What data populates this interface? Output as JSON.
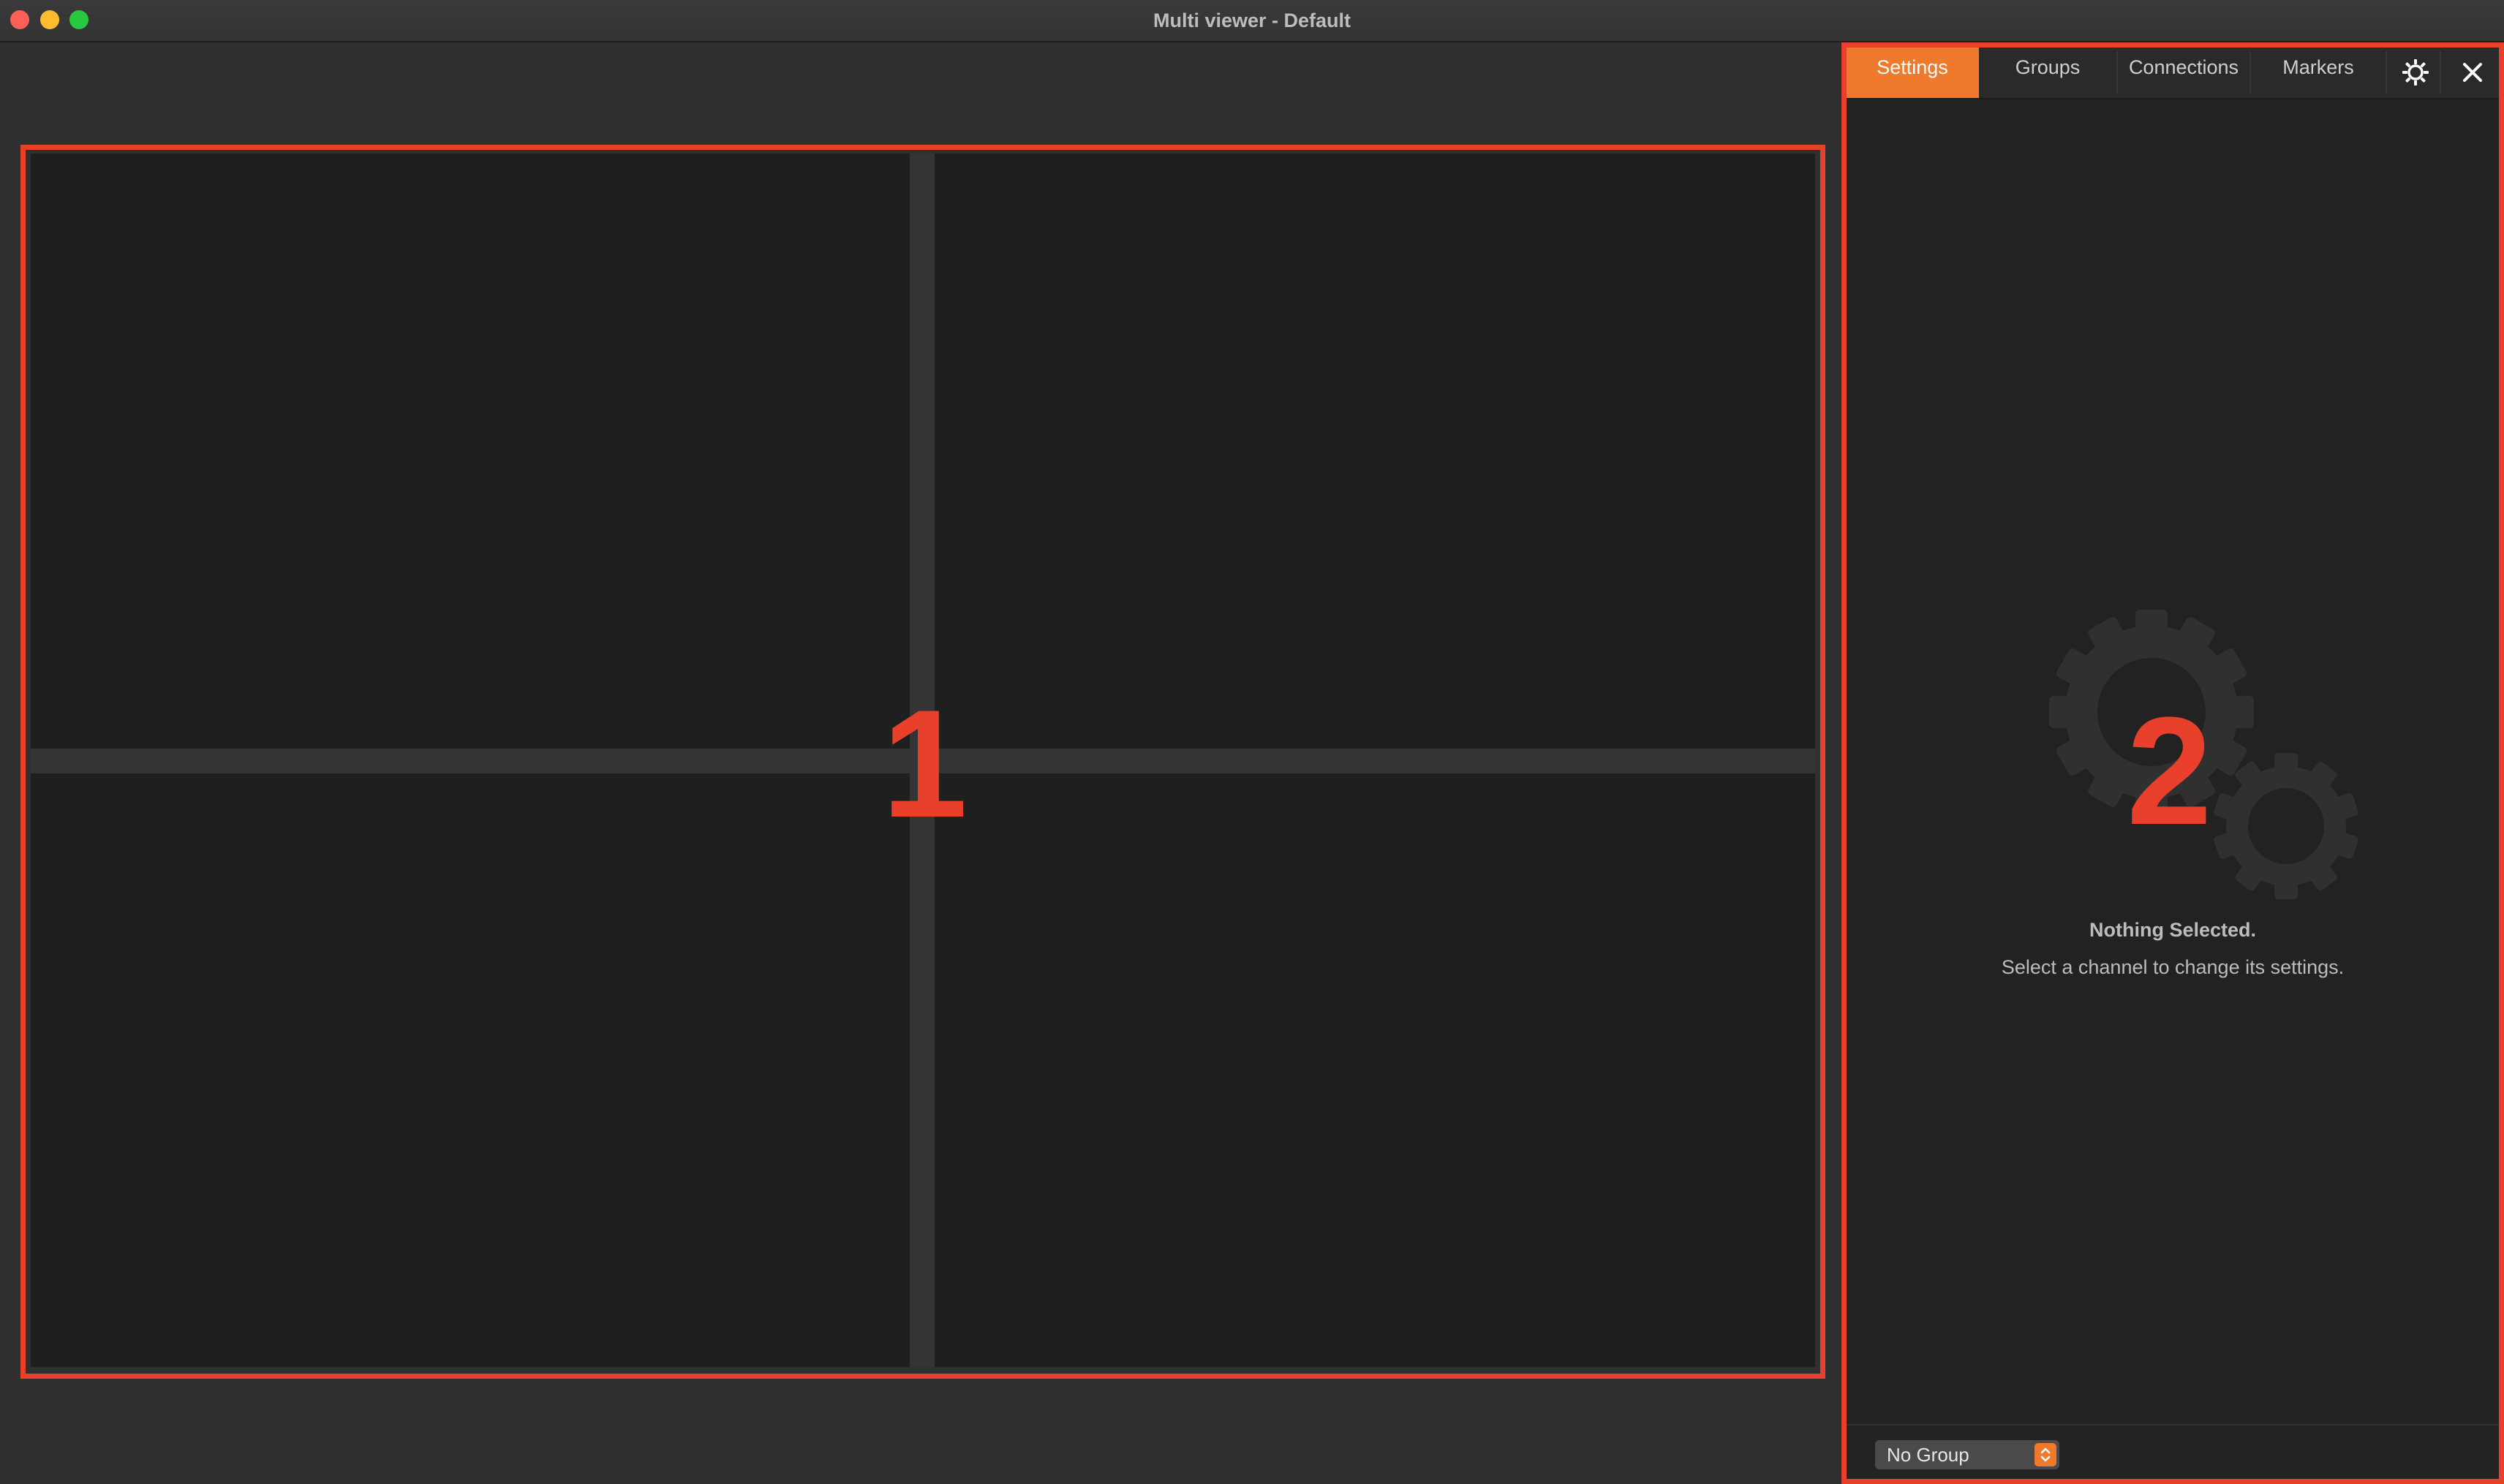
{
  "window": {
    "title": "Multi viewer - Default"
  },
  "viewer": {
    "layout": "2x2",
    "callout": "1"
  },
  "panel": {
    "callout": "2",
    "tabs": [
      {
        "label": "Settings",
        "active": true
      },
      {
        "label": "Groups",
        "active": false
      },
      {
        "label": "Connections",
        "active": false
      },
      {
        "label": "Markers",
        "active": false
      }
    ],
    "settings_icon": "gear-icon",
    "close_icon": "close-icon",
    "empty_state": {
      "title": "Nothing Selected.",
      "subtitle": "Select a channel to change its settings.",
      "icon": "gears-icon"
    },
    "footer": {
      "group_select": {
        "value": "No Group"
      }
    }
  },
  "colors": {
    "accent": "#f07a2c",
    "callout": "#e8402a",
    "background": "#2f2f2f",
    "cell": "#1f1f1f"
  }
}
